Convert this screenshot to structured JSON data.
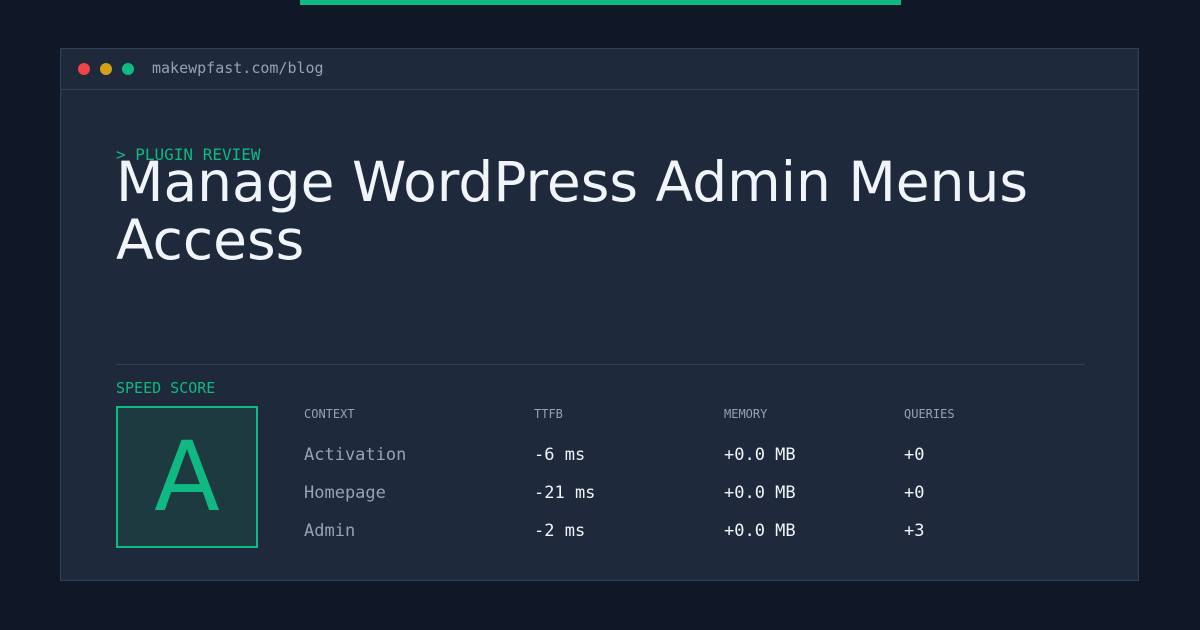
{
  "window": {
    "url": "makewpfast.com/blog"
  },
  "article": {
    "kicker": "> PLUGIN REVIEW",
    "title": "Manage WordPress Admin Menus Access"
  },
  "speed": {
    "label": "SPEED SCORE",
    "grade": "A"
  },
  "metrics_table": {
    "headers": [
      "CONTEXT",
      "TTFB",
      "MEMORY",
      "QUERIES"
    ],
    "rows": [
      {
        "context": "Activation",
        "ttfb": "-6 ms",
        "memory": "+0.0 MB",
        "queries": "+0"
      },
      {
        "context": "Homepage",
        "ttfb": "-21 ms",
        "memory": "+0.0 MB",
        "queries": "+0"
      },
      {
        "context": "Admin",
        "ttfb": "-2 ms",
        "memory": "+0.0 MB",
        "queries": "+3"
      }
    ]
  },
  "colors": {
    "background": "#101828",
    "panel": "#1e293b",
    "accent": "#10b981",
    "dot_red": "#ef4444",
    "dot_yellow": "#d4a017",
    "dot_green": "#10b981"
  }
}
